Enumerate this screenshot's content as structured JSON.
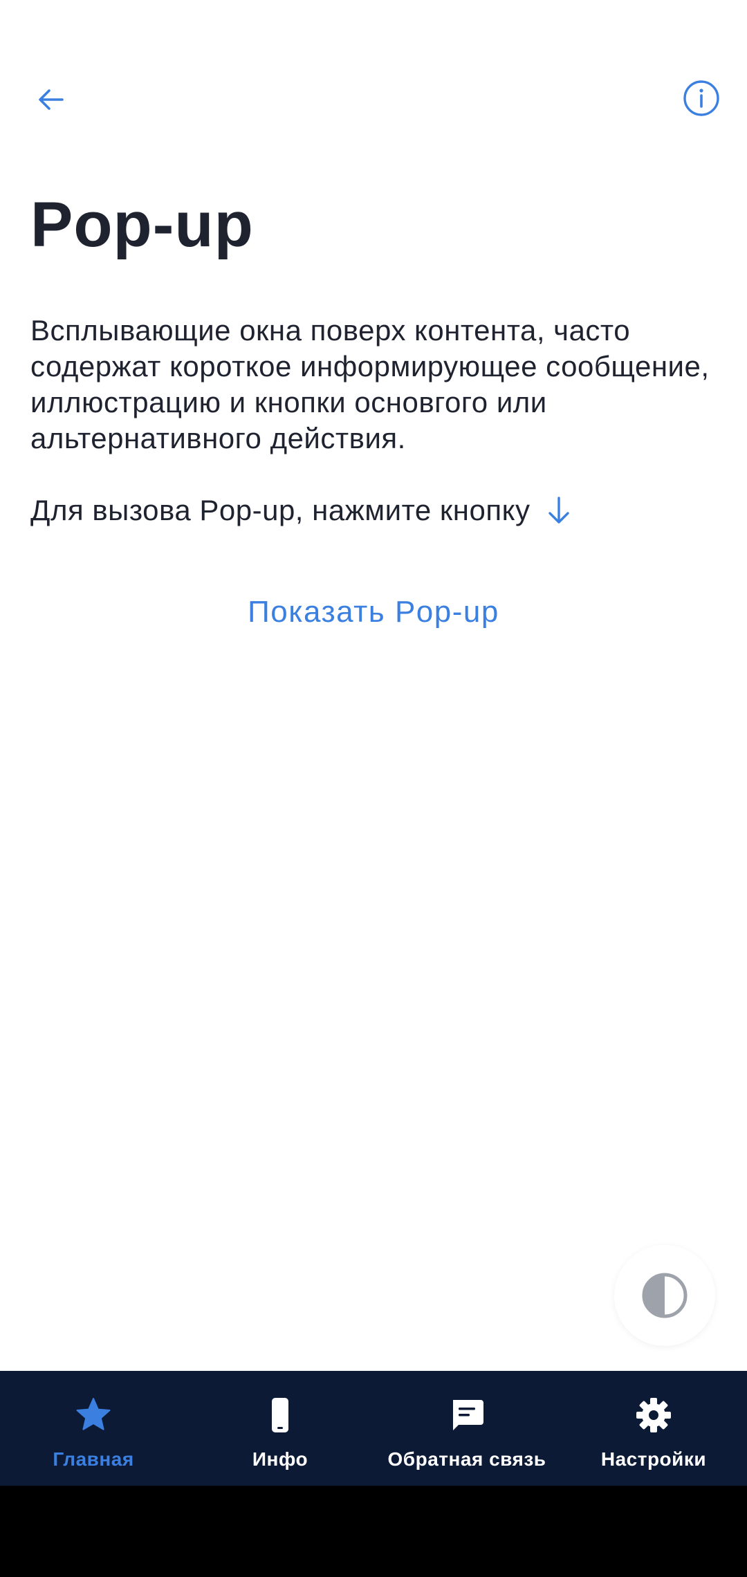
{
  "header": {
    "back_icon": "arrow-left-icon",
    "info_icon": "info-circle-icon"
  },
  "page": {
    "title": "Pop-up",
    "description": "Всплывающие окна поверх контента, часто содержат короткое информирующее сообщение, иллюстрацию и кнопки основгого или альтернативного действия.",
    "hint": "Для вызова Pop-up, нажмите кнопку",
    "hint_icon": "arrow-down-icon",
    "show_button_label": "Показать Pop-up"
  },
  "theme_toggle": {
    "icon": "contrast-icon"
  },
  "bottom_nav": {
    "items": [
      {
        "label": "Главная",
        "icon": "star-icon",
        "active": true
      },
      {
        "label": "Инфо",
        "icon": "phone-icon",
        "active": false
      },
      {
        "label": "Обратная связь",
        "icon": "chat-icon",
        "active": false
      },
      {
        "label": "Настройки",
        "icon": "gear-icon",
        "active": false
      }
    ]
  },
  "colors": {
    "accent": "#3b80e0",
    "text": "#1f2330",
    "nav_background": "#0c1a36",
    "nav_label": "#ffffff",
    "background": "#ffffff"
  }
}
